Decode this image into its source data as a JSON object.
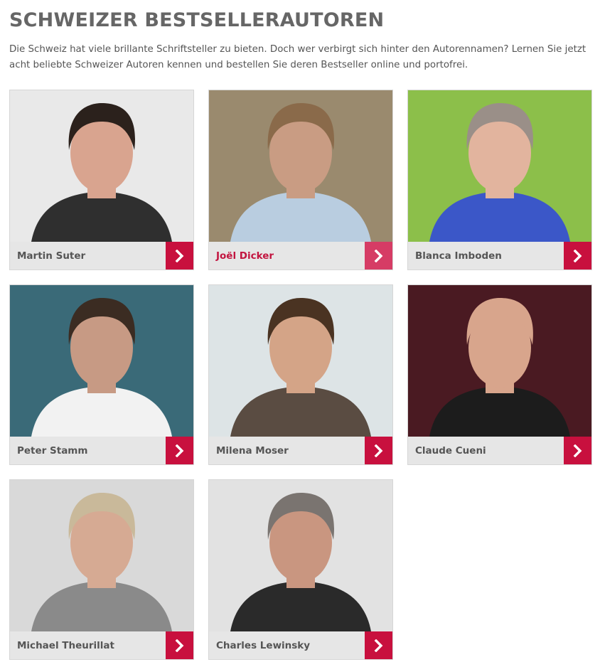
{
  "header": {
    "title": "SCHWEIZER BESTSELLERAUTOREN",
    "intro": "Die Schweiz hat viele brillante Schriftsteller zu bieten. Doch wer verbirgt sich hinter den Autorennamen? Lernen Sie jetzt acht beliebte Schweizer Autoren kennen und bestellen Sie deren Bestseller online und portofrei."
  },
  "authors": [
    {
      "name": "Martin Suter",
      "bg": "#e9e9e9",
      "skin": "#d9a48f",
      "hair": "#2b211c",
      "shirt": "#2f2f2f",
      "active": false
    },
    {
      "name": "Joël Dicker",
      "bg": "#9a8a6e",
      "skin": "#c99c83",
      "hair": "#8a6a4a",
      "shirt": "#b9cde0",
      "active": true
    },
    {
      "name": "Blanca Imboden",
      "bg": "#8cbf4a",
      "skin": "#e2b49e",
      "hair": "#9a8f88",
      "shirt": "#3b57c8",
      "active": false
    },
    {
      "name": "Peter Stamm",
      "bg": "#3a6a78",
      "skin": "#c79a84",
      "hair": "#3b2c22",
      "shirt": "#f2f2f2",
      "active": false
    },
    {
      "name": "Milena Moser",
      "bg": "#dde4e6",
      "skin": "#d4a487",
      "hair": "#4a3322",
      "shirt": "#5a4c42",
      "active": false
    },
    {
      "name": "Claude Cueni",
      "bg": "#4a1a22",
      "skin": "#d8a58c",
      "hair": "#d8a58c",
      "shirt": "#1c1c1c",
      "active": false
    },
    {
      "name": "Michael Theurillat",
      "bg": "#d9d9d9",
      "skin": "#d6aa93",
      "hair": "#c9b99a",
      "shirt": "#8a8a8a",
      "active": false
    },
    {
      "name": "Charles Lewinsky",
      "bg": "#e2e2e2",
      "skin": "#c99680",
      "hair": "#7a7470",
      "shirt": "#2a2a2a",
      "active": false
    }
  ],
  "icons": {
    "arrow": "chevron-right-icon"
  },
  "colors": {
    "accent": "#c8103e",
    "accent_active": "#d63c65",
    "title": "#666666",
    "text": "#555555",
    "caption_bg": "#e6e6e6"
  }
}
